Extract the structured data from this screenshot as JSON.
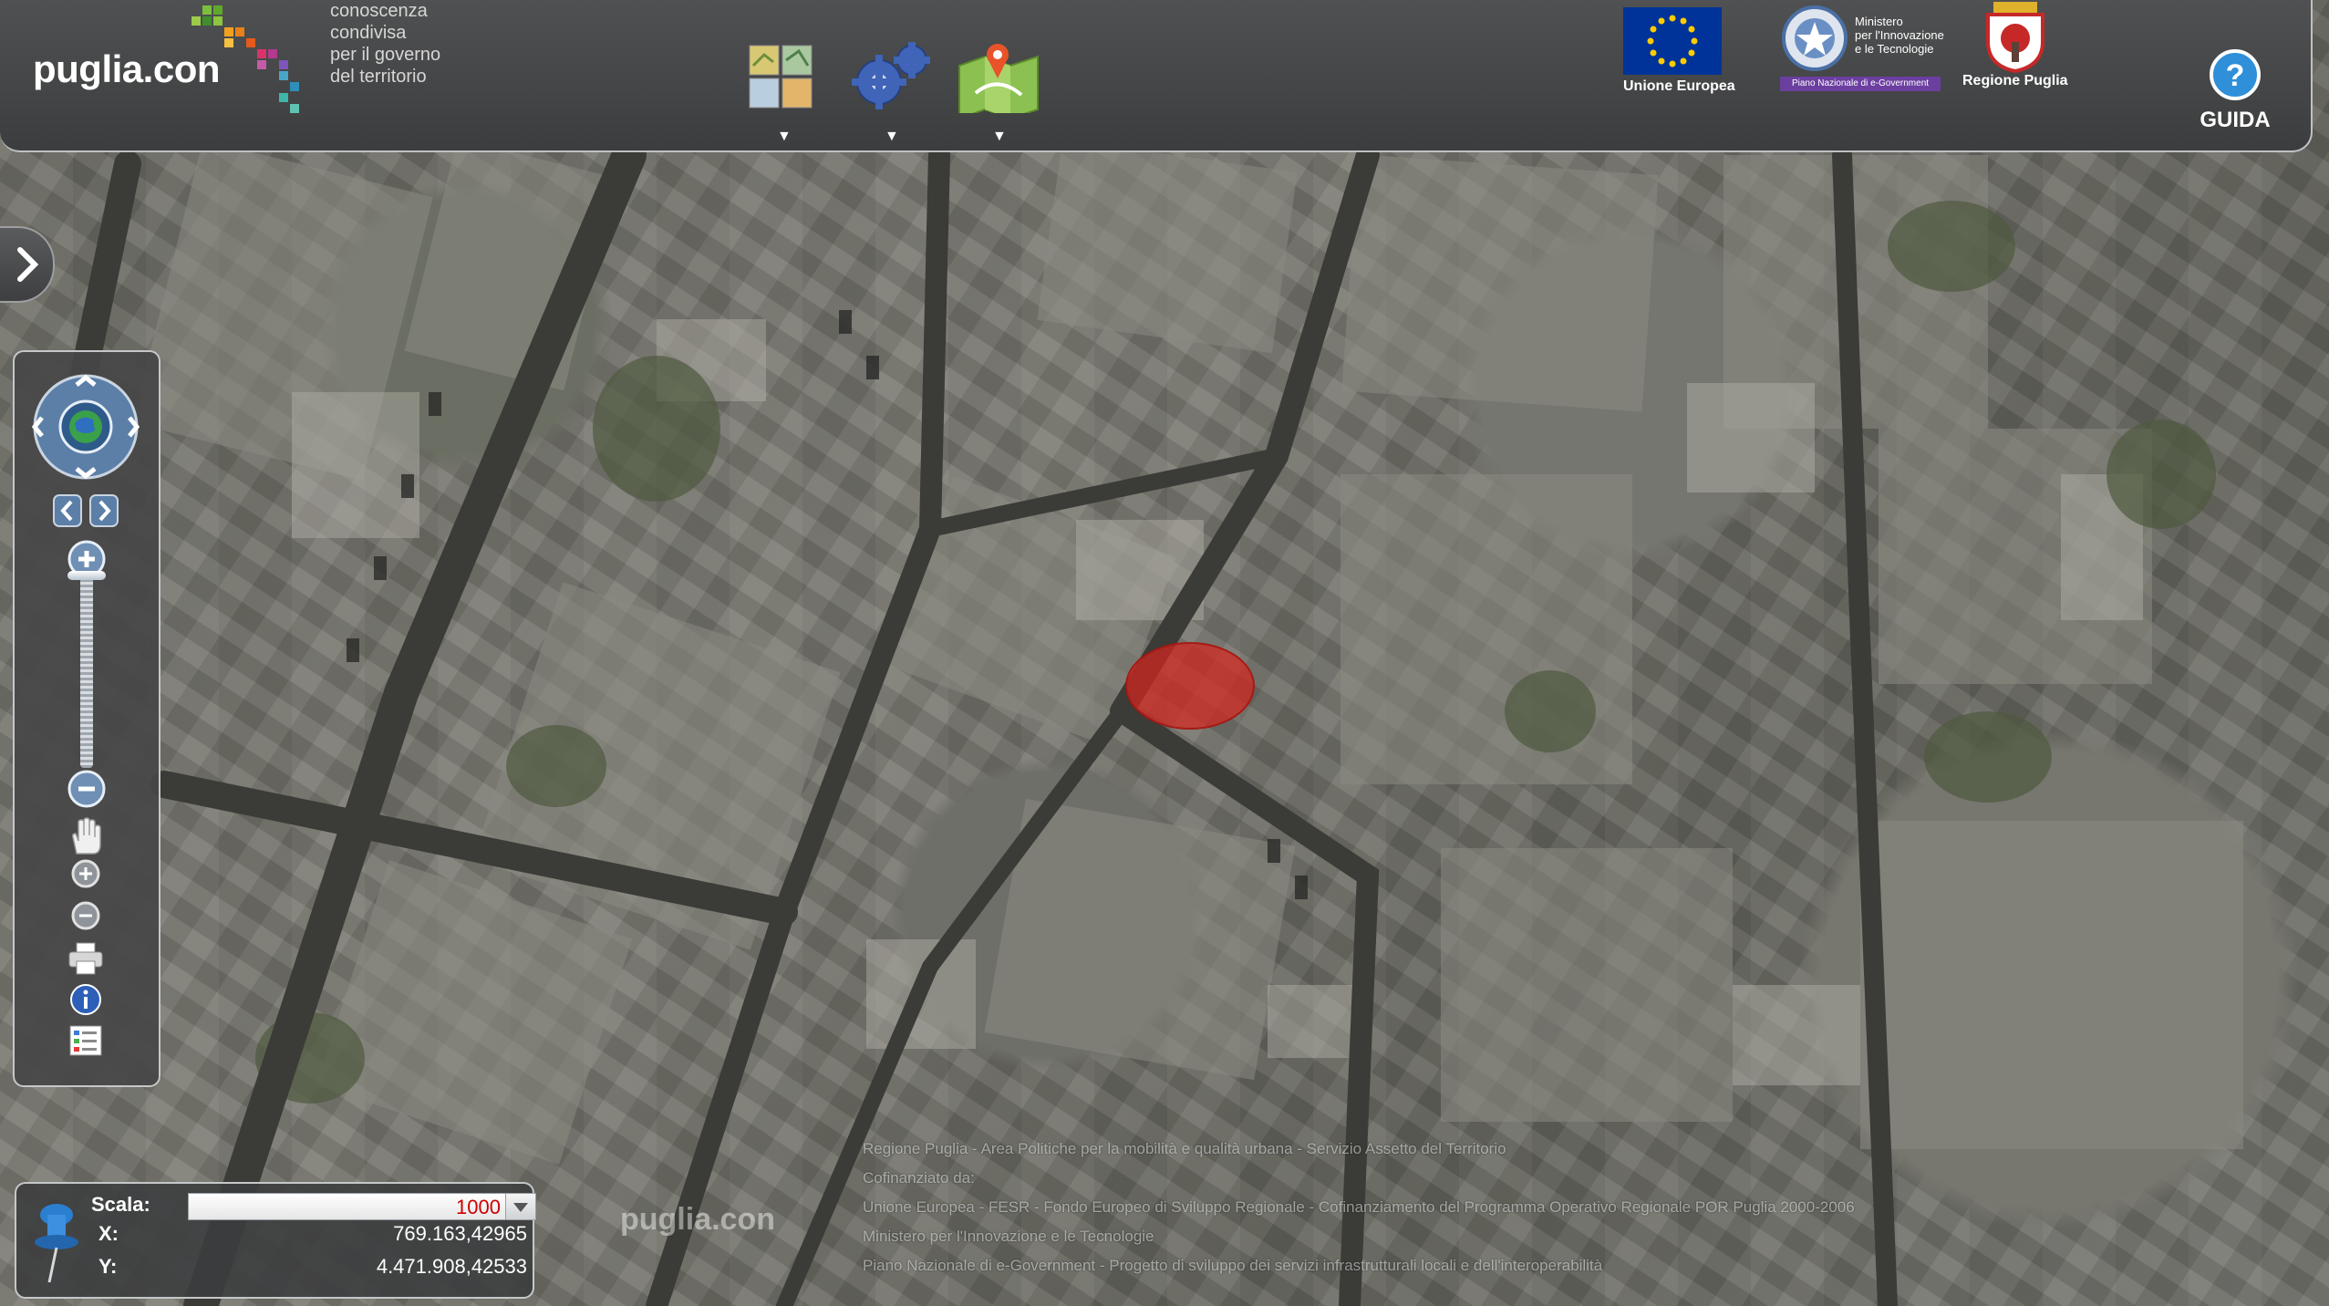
{
  "header": {
    "brand_name": "puglia.con",
    "tagline_1": "conoscenza",
    "tagline_2": "condivisa",
    "tagline_3": "per il governo",
    "tagline_4": "del territorio",
    "toolbar": [
      {
        "name": "layers-icon",
        "arrow": "▼"
      },
      {
        "name": "gear-icon",
        "arrow": "▼"
      },
      {
        "name": "map-icon",
        "arrow": "▼"
      }
    ],
    "logos": {
      "eu_label": "Unione Europea",
      "ministry_line1": "Ministero",
      "ministry_line2": "per l'Innovazione",
      "ministry_line3": "e le Tecnologie",
      "ministry_plan": "Piano Nazionale di e-Government",
      "region_label": "Regione Puglia"
    },
    "guida_label": "GUIDA"
  },
  "coords": {
    "scala_label": "Scala:",
    "scala_value": "1000",
    "x_label": "X:",
    "x_value": "769.163,42965",
    "y_label": "Y:",
    "y_value": "4.471.908,42533"
  },
  "map": {
    "attribution": [
      "Regione Puglia - Area Politiche per la mobilità e qualità urbana - Servizio Assetto del Territorio",
      "Cofinanziato da:",
      "Unione Europea - FESR - Fondo Europeo di Sviluppo Regionale - Cofinanziamento del Programma Operativo Regionale POR Puglia 2000-2006",
      "Ministero per l'Innovazione e le Tecnologie",
      "Piano Nazionale di e-Government - Progetto di sviluppo dei servizi infrastrutturali locali e dell'interoperabilità"
    ],
    "watermark": "puglia.con"
  },
  "colors": {
    "header_bg": "#46474a",
    "selection": "#d6261e",
    "scala_value_color": "#cc0000",
    "eu_blue": "#003399"
  }
}
